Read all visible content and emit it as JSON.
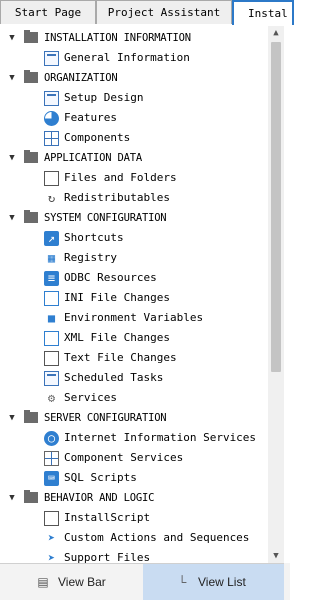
{
  "tabs": [
    {
      "label": "Start Page"
    },
    {
      "label": "Project Assistant"
    },
    {
      "label": "Instal"
    }
  ],
  "tree": [
    {
      "label": "INSTALLATION INFORMATION",
      "items": [
        {
          "label": "General Information",
          "icon": "general-information-icon"
        }
      ]
    },
    {
      "label": "ORGANIZATION",
      "items": [
        {
          "label": "Setup Design",
          "icon": "setup-design-icon"
        },
        {
          "label": "Features",
          "icon": "features-icon"
        },
        {
          "label": "Components",
          "icon": "components-icon"
        }
      ]
    },
    {
      "label": "APPLICATION DATA",
      "items": [
        {
          "label": "Files and Folders",
          "icon": "files-and-folders-icon"
        },
        {
          "label": "Redistributables",
          "icon": "redistributables-icon"
        }
      ]
    },
    {
      "label": "SYSTEM CONFIGURATION",
      "items": [
        {
          "label": "Shortcuts",
          "icon": "shortcuts-icon"
        },
        {
          "label": "Registry",
          "icon": "registry-icon"
        },
        {
          "label": "ODBC Resources",
          "icon": "odbc-resources-icon"
        },
        {
          "label": "INI File Changes",
          "icon": "ini-file-changes-icon"
        },
        {
          "label": "Environment Variables",
          "icon": "environment-variables-icon"
        },
        {
          "label": "XML File Changes",
          "icon": "xml-file-changes-icon"
        },
        {
          "label": "Text File Changes",
          "icon": "text-file-changes-icon"
        },
        {
          "label": "Scheduled Tasks",
          "icon": "scheduled-tasks-icon"
        },
        {
          "label": "Services",
          "icon": "services-icon"
        }
      ]
    },
    {
      "label": "SERVER CONFIGURATION",
      "items": [
        {
          "label": "Internet Information Services",
          "icon": "globe-icon"
        },
        {
          "label": "Component Services",
          "icon": "component-services-icon"
        },
        {
          "label": "SQL Scripts",
          "icon": "sql-scripts-icon"
        }
      ]
    },
    {
      "label": "BEHAVIOR AND LOGIC",
      "items": [
        {
          "label": "InstallScript",
          "icon": "installscript-icon"
        },
        {
          "label": "Custom Actions and Sequences",
          "icon": "custom-actions-icon"
        },
        {
          "label": "Support Files",
          "icon": "support-files-icon"
        }
      ]
    }
  ],
  "bottom": {
    "view_bar": "View Bar",
    "view_list": "View List"
  },
  "colors": {
    "accent": "#2c79c8",
    "selected_bottom": "#c9dcf2",
    "folder": "#6b6b6b"
  }
}
